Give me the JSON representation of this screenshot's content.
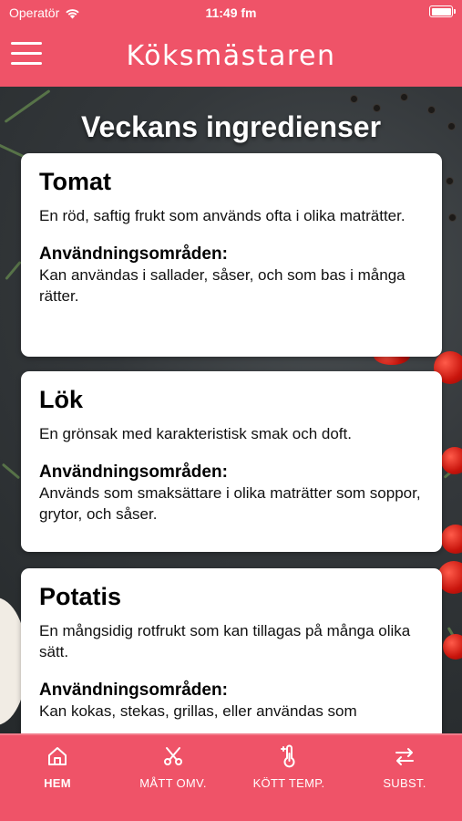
{
  "status_bar": {
    "carrier": "Operatör",
    "time": "11:49 fm"
  },
  "nav": {
    "title": "Köksmästaren"
  },
  "page": {
    "heading": "Veckans ingredienser"
  },
  "ingredients": [
    {
      "name": "Tomat",
      "description": "En röd, saftig frukt som används ofta i olika maträtter.",
      "usage_heading": "Användningsområden:",
      "usage": "Kan användas i sallader, såser, och som bas i många rätter."
    },
    {
      "name": "Lök",
      "description": "En grönsak med karakteristisk smak och doft.",
      "usage_heading": "Användningsområden:",
      "usage": "Används som smaksättare i olika maträtter som soppor, grytor, och såser."
    },
    {
      "name": "Potatis",
      "description": "En mångsidig rotfrukt som kan tillagas på många olika sätt.",
      "usage_heading": "Användningsområden:",
      "usage": "Kan kokas, stekas, grillas, eller användas som"
    }
  ],
  "tabs": [
    {
      "label": "HEM",
      "icon": "home-icon",
      "active": true
    },
    {
      "label": "MÅTT OMV.",
      "icon": "scissors-icon",
      "active": false
    },
    {
      "label": "KÖTT TEMP.",
      "icon": "thermometer-icon",
      "active": false
    },
    {
      "label": "SUBST.",
      "icon": "swap-icon",
      "active": false
    }
  ],
  "colors": {
    "accent": "#ef5368",
    "card_background": "#ffffff",
    "text_on_accent": "#ffffff"
  }
}
